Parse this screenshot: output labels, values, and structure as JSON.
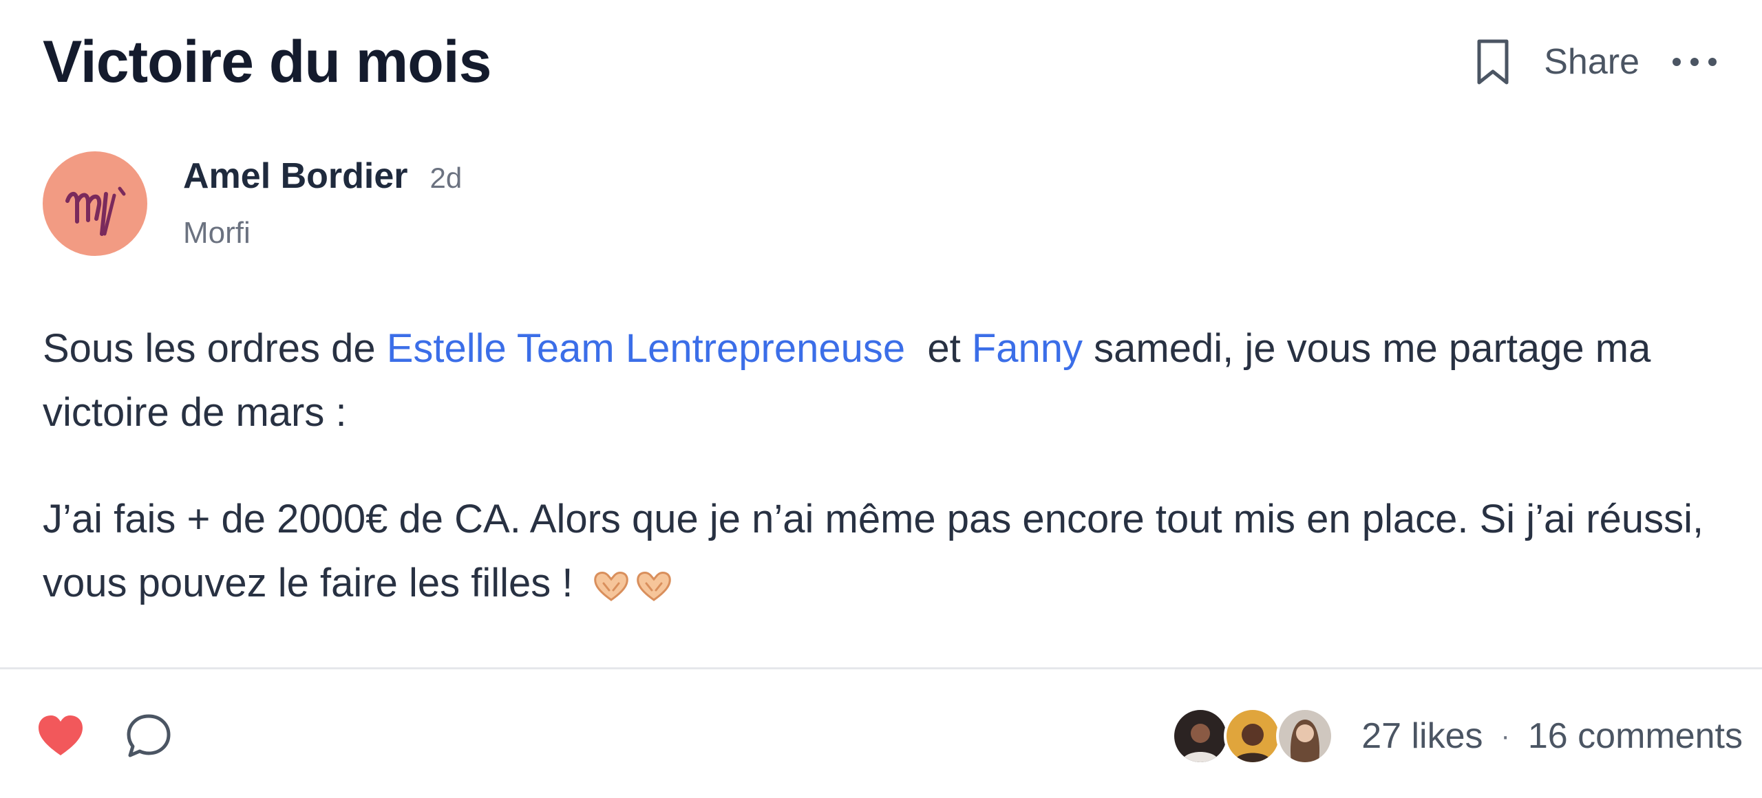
{
  "post": {
    "title": "Victoire du mois",
    "actions": {
      "bookmark_icon": "bookmark-icon",
      "share_label": "Share",
      "more_icon": "more-horizontal-icon"
    },
    "author": {
      "name": "Amel Bordier",
      "time": "2d",
      "group": "Morfi",
      "avatar_initials": "M",
      "avatar_color": "#f29b83"
    },
    "body": {
      "p1": {
        "t1": "Sous les ordres de ",
        "mention1": "Estelle Team Lentrepreneuse",
        "t2": "  et ",
        "mention2": "Fanny",
        "t3": " samedi, je vous me partage ma victoire de mars :"
      },
      "p2": {
        "text": "J’ai fais + de 2000€ de CA. Alors que je n’ai même pas encore tout mis en place. Si j’ai réussi, vous pouvez le faire les filles ! ",
        "emoji_icon": "heart-hands-emoji"
      }
    },
    "footer": {
      "like_icon": "heart-icon",
      "comment_icon": "comment-icon",
      "likes": "27 likes",
      "separator": "·",
      "comments": "16 comments"
    },
    "colors": {
      "mention": "#3b6ee8",
      "like_heart": "#f2585b"
    }
  }
}
